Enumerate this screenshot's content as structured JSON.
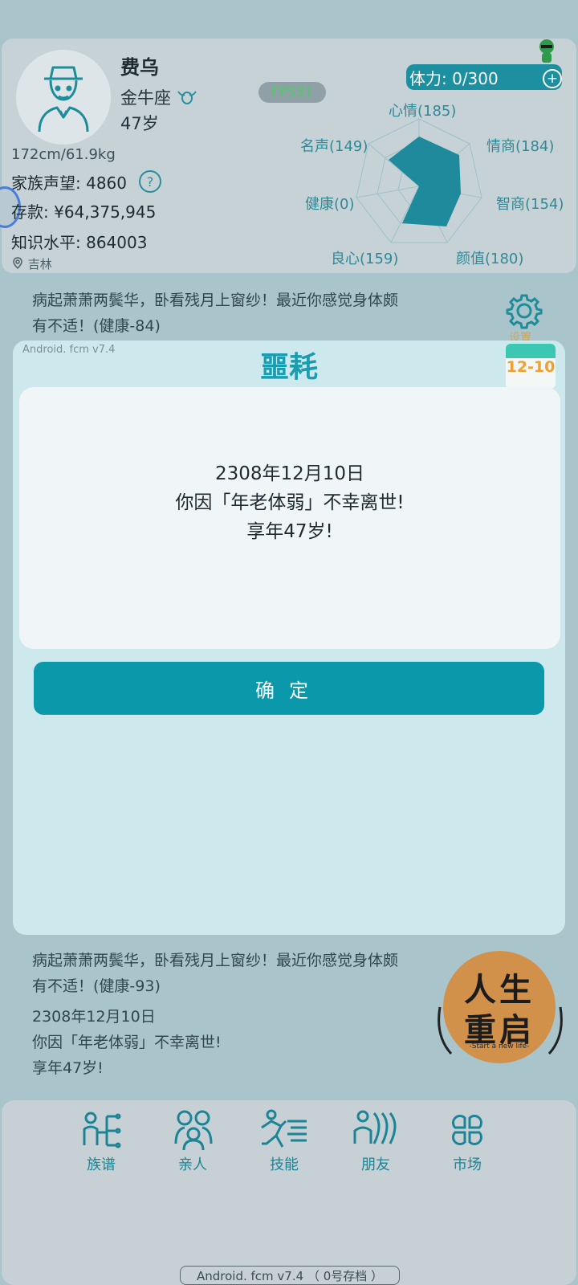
{
  "profile": {
    "name": "费乌",
    "zodiac": "金牛座",
    "age": "47岁",
    "height_weight": "172cm/61.9kg",
    "family_fame": "家族声望: 4860",
    "savings": "存款: ¥64,375,945",
    "knowledge": "知识水平: 864003",
    "location": "吉林",
    "help": "?"
  },
  "fps": "FPS31",
  "stamina": {
    "label": "体力: 0/300",
    "plus": "+"
  },
  "radar": {
    "labels": {
      "mood": "心情(185)",
      "eq": "情商(184)",
      "iq": "智商(154)",
      "looks": "颜值(180)",
      "conscience": "良心(159)",
      "health": "健康(0)",
      "fame": "名声(149)"
    }
  },
  "log_top": {
    "line1": "病起萧萧两鬓华，卧看残月上窗纱！最近你感觉身体颇",
    "line2": "有不适！(健康-84)"
  },
  "settings": {
    "label": "设置",
    "icon": "gear-icon"
  },
  "calendar": {
    "date": "12-10",
    "icon": "calendar-icon"
  },
  "modal": {
    "version": "Android. fcm v7.4",
    "title": "噩耗",
    "line1": "2308年12月10日",
    "line2": "你因「年老体弱」不幸离世!",
    "line3": "享年47岁!",
    "confirm": "确定"
  },
  "log_bottom": {
    "line1": "病起萧萧两鬓华，卧看残月上窗纱！最近你感觉身体颇",
    "line2": "有不适！(健康-93)",
    "line3": "2308年12月10日",
    "line4": "你因「年老体弱」不幸离世!",
    "line5": "享年47岁!"
  },
  "restart": {
    "line1": "人生",
    "line2": "重启",
    "sub": "-Start a new life-"
  },
  "nav": [
    {
      "label": "族谱",
      "icon": "family-tree-icon"
    },
    {
      "label": "亲人",
      "icon": "relatives-icon"
    },
    {
      "label": "技能",
      "icon": "skills-icon"
    },
    {
      "label": "朋友",
      "icon": "friends-icon"
    },
    {
      "label": "市场",
      "icon": "market-icon"
    }
  ],
  "footer": "Android. fcm v7.4  （ 0号存档 ）",
  "colors": {
    "accent": "#0c98ab",
    "radar_fill": "#1e8a9c",
    "background": "#a9c4cb"
  }
}
